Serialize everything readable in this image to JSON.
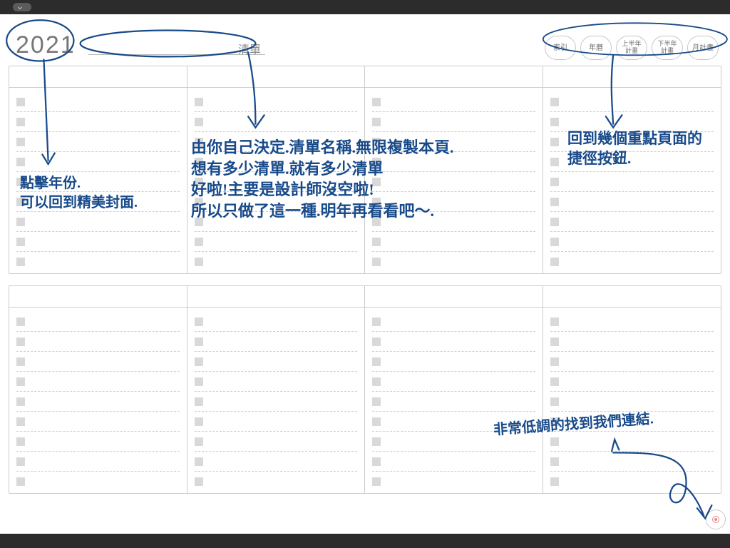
{
  "header": {
    "year": "2021",
    "title_label": "清單",
    "nav": [
      {
        "label": "索引"
      },
      {
        "label": "年曆"
      },
      {
        "label": "上半年\n計畫"
      },
      {
        "label": "下半年\n計畫"
      },
      {
        "label": "月計畫"
      }
    ]
  },
  "grid": {
    "blocks": 2,
    "columns_per_block": 4,
    "rows_per_column": 9
  },
  "annotations": {
    "year_note": "點擊年份.\n可以回到精美封面.",
    "title_note": "由你自己決定.清單名稱.無限複製本頁.\n想有多少清單.就有多少清單\n好啦!主要是設計師沒空啦!\n所以只做了這一種.明年再看看吧～.",
    "nav_note": "回到幾個重點頁面的\n捷徑按鈕.",
    "corner_note": "非常低調的找到我們連結."
  },
  "colors": {
    "ink": "#184a8a",
    "grid_line": "#cccccc",
    "checkbox": "#d9d9d9",
    "text_muted": "#777777",
    "accent_dot": "#e58b8d"
  }
}
